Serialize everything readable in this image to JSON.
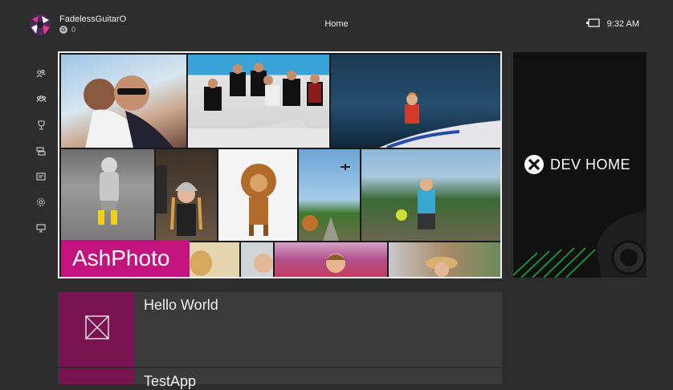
{
  "header": {
    "gamertag": "FadelessGuitarO",
    "gamerscore": "0",
    "gamerscore_badge": "G",
    "page_title": "Home",
    "clock": "9:32 AM"
  },
  "sidebar": {
    "items": [
      {
        "icon": "friends-icon"
      },
      {
        "icon": "party-icon"
      },
      {
        "icon": "achievements-icon"
      },
      {
        "icon": "snap-icon"
      },
      {
        "icon": "messages-icon"
      },
      {
        "icon": "settings-icon"
      },
      {
        "icon": "tv-icon"
      }
    ]
  },
  "featured": {
    "app_name": "AshPhoto"
  },
  "dev_home": {
    "label": "DEV HOME"
  },
  "apps": [
    {
      "name": "Hello World",
      "color": "#7a1450"
    },
    {
      "name": "TestApp",
      "color": "#7a1450"
    }
  ],
  "colors": {
    "background": "#2d2d2d",
    "accent_magenta": "#c2137e",
    "app_tile": "#7a1450"
  }
}
